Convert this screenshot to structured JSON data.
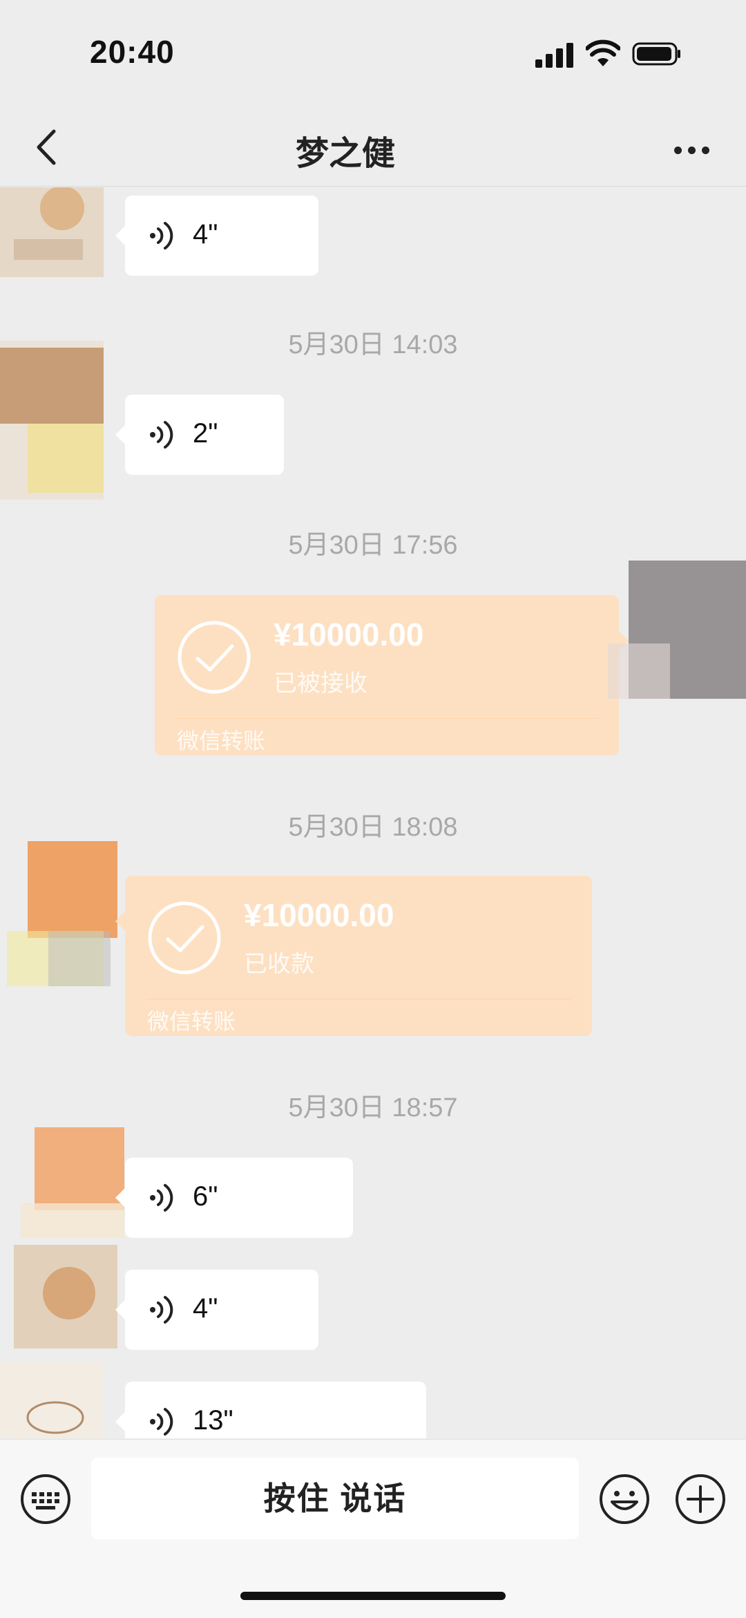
{
  "status_bar": {
    "time": "20:40"
  },
  "nav": {
    "title": "梦之健"
  },
  "messages": [
    {
      "type": "voice",
      "duration": "4\""
    },
    {
      "type": "timestamp",
      "text": "5月30日 14:03"
    },
    {
      "type": "voice",
      "duration": "2\""
    },
    {
      "type": "timestamp",
      "text": "5月30日 17:56"
    },
    {
      "type": "transfer",
      "side": "right",
      "amount": "¥10000.00",
      "status": "已被接收",
      "source": "微信转账"
    },
    {
      "type": "timestamp",
      "text": "5月30日 18:08"
    },
    {
      "type": "transfer",
      "side": "left",
      "amount": "¥10000.00",
      "status": "已收款",
      "source": "微信转账"
    },
    {
      "type": "timestamp",
      "text": "5月30日 18:57"
    },
    {
      "type": "voice",
      "duration": "6\""
    },
    {
      "type": "voice",
      "duration": "4\""
    },
    {
      "type": "voice",
      "duration": "13\""
    }
  ],
  "input_bar": {
    "hold_to_talk": "按住 说话"
  },
  "icons": {
    "back": "chevron-left-icon",
    "more": "more-dots-icon",
    "voice": "voice-wave-icon",
    "transfer": "check-circle-icon",
    "keyboard": "keyboard-icon",
    "emoji": "emoji-icon",
    "plus": "plus-circle-icon"
  },
  "colors": {
    "background": "#ededed",
    "bubble": "#ffffff",
    "transfer_bubble": "#fde0c2",
    "timestamp": "#a8a8a8"
  }
}
